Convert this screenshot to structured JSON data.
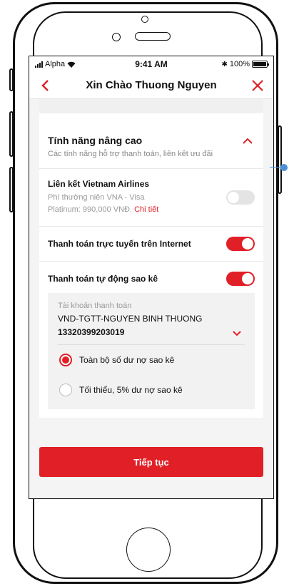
{
  "status_bar": {
    "carrier": "Alpha",
    "time": "9:41 AM",
    "battery": "100%"
  },
  "navbar": {
    "title": "Xin Chào Thuong Nguyen"
  },
  "advanced": {
    "title": "Tính năng nâng cao",
    "subtitle": "Các tính năng hỗ trợ thanh toán, liên kết ưu đãi",
    "expanded": true
  },
  "features": [
    {
      "title": "Liên kết Vietnam Airlines",
      "desc_line1": "Phí thường niên VNA - Visa",
      "desc_line2": "Platinum: 990,000 VNĐ.",
      "link": "Chi tiết",
      "enabled": false
    },
    {
      "title": "Thanh toán trực tuyến trên Internet",
      "enabled": true
    },
    {
      "title": "Thanh toán tự động sao kê",
      "enabled": true
    }
  ],
  "payment_account": {
    "label": "Tài khoản thanh toán",
    "name": "VND-TGTT-NGUYEN BINH THUONG",
    "number": "13320399203019"
  },
  "payment_options": [
    {
      "label": "Toàn bộ số dư nợ sao kê",
      "selected": true
    },
    {
      "label": "Tối thiểu, 5% dư nợ sao kê",
      "selected": false
    }
  ],
  "continue_label": "Tiếp tục",
  "colors": {
    "accent": "#e01f26",
    "annotation": "#4a90d9"
  }
}
